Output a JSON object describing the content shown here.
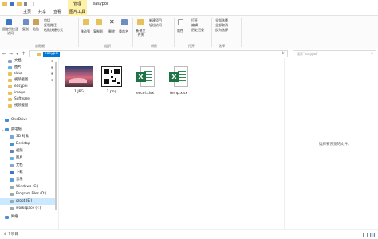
{
  "window": {
    "manage_tab": "管理",
    "title": "easypoi"
  },
  "ribbon_tabs": [
    "文件",
    "主页",
    "共享",
    "查看",
    "图片工具"
  ],
  "ribbon": {
    "clipboard": {
      "pin_label": "固定到快速访问",
      "copy_label": "复制",
      "paste_label": "粘贴",
      "cut_label": "剪切",
      "copy_path_label": "复制路径",
      "paste_shortcut_label": "粘贴快捷方式",
      "group_label": "剪贴板"
    },
    "organize": {
      "move_to_label": "移动到",
      "copy_to_label": "复制到",
      "delete_label": "删除",
      "rename_label": "重命名",
      "group_label": "组织"
    },
    "new": {
      "new_folder_label": "新建文件夹",
      "new_item_label": "新建项目",
      "easy_access_label": "轻松访问",
      "group_label": "新建"
    },
    "open": {
      "properties_label": "属性",
      "open_label": "打开",
      "edit_label": "编辑",
      "history_label": "历史记录",
      "group_label": "打开"
    },
    "select": {
      "select_all_label": "全部选择",
      "select_none_label": "全部取消",
      "invert_label": "反向选择",
      "group_label": "选择"
    }
  },
  "address": {
    "path": "easypoi",
    "search_placeholder": "搜索\"easypoi\""
  },
  "sidebar": {
    "items": [
      {
        "label": "文档",
        "pinned": true
      },
      {
        "label": "图片",
        "pinned": true
      },
      {
        "label": "data",
        "pinned": true
      },
      {
        "label": "视频截图",
        "pinned": true
      },
      {
        "label": "easypoi",
        "pinned": false
      },
      {
        "label": "image",
        "pinned": false
      },
      {
        "label": "Software",
        "pinned": false
      },
      {
        "label": "视频截图",
        "pinned": false
      },
      {
        "label": "OneDrive",
        "pinned": false
      },
      {
        "label": "此电脑",
        "pinned": false
      },
      {
        "label": "3D 对象",
        "pinned": false
      },
      {
        "label": "Desktop",
        "pinned": false
      },
      {
        "label": "视频",
        "pinned": false
      },
      {
        "label": "图片",
        "pinned": false
      },
      {
        "label": "文档",
        "pinned": false
      },
      {
        "label": "下载",
        "pinned": false
      },
      {
        "label": "音乐",
        "pinned": false
      },
      {
        "label": "Windows (C:)",
        "pinned": false
      },
      {
        "label": "Program Files (D:)",
        "pinned": false
      },
      {
        "label": "groot (E:)",
        "pinned": false
      },
      {
        "label": "workspace (F:)",
        "pinned": false
      },
      {
        "label": "网络",
        "pinned": false
      }
    ]
  },
  "files": [
    {
      "name": "1.JPG",
      "kind": "image"
    },
    {
      "name": "2.png",
      "kind": "qr"
    },
    {
      "name": "excel.xlsx",
      "kind": "excel"
    },
    {
      "name": "temp.xlsx",
      "kind": "excel"
    }
  ],
  "preview_message": "选择要预览的文件。",
  "status": {
    "text": "4 个项目"
  },
  "colors": {
    "accent": "#1979ca",
    "selection": "#0078d7",
    "excel": "#1f7244",
    "manage_tab": "#fff2a8"
  }
}
